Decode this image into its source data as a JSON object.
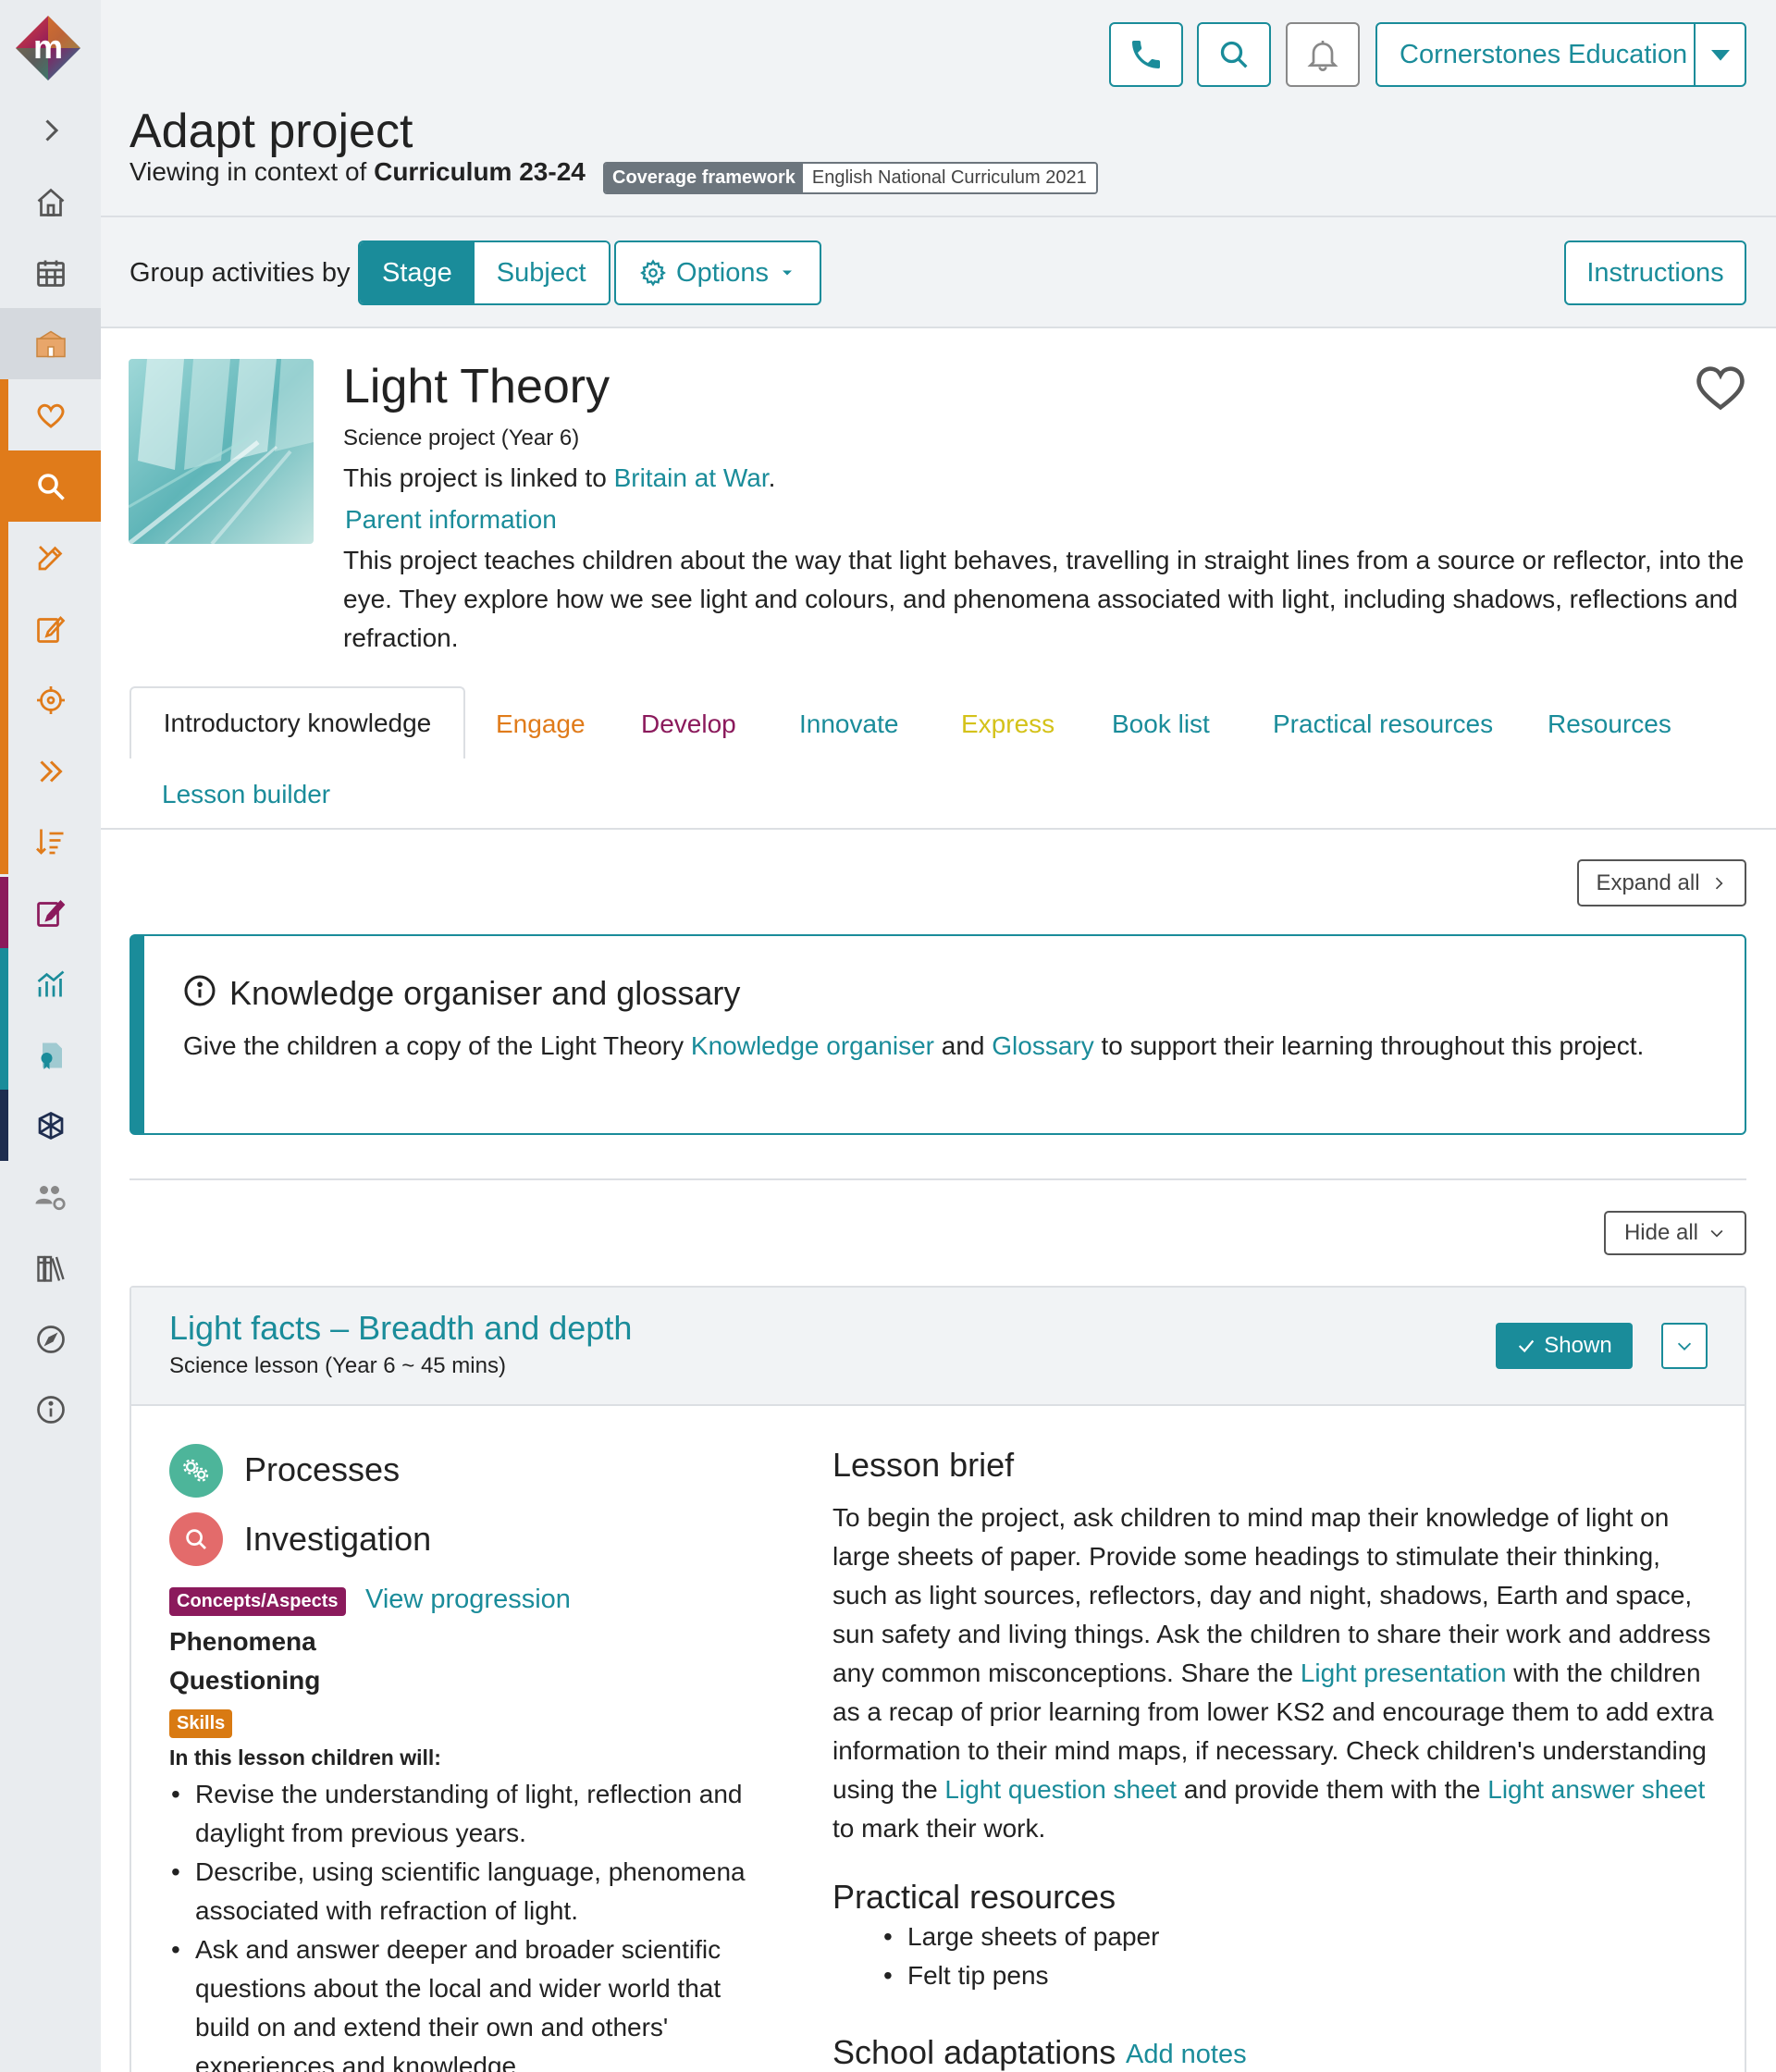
{
  "topbar": {
    "org_name": "Cornerstones Education"
  },
  "header": {
    "title": "Adapt project",
    "context_prefix": "Viewing in context of ",
    "context_value": "Curriculum 23-24",
    "coverage_key": "Coverage framework",
    "coverage_value": "English National Curriculum 2021"
  },
  "toolbar": {
    "group_label": "Group activities by",
    "stage_label": "Stage",
    "subject_label": "Subject",
    "options_label": "Options",
    "instructions_label": "Instructions"
  },
  "project": {
    "title": "Light Theory",
    "subtitle": "Science project (Year 6)",
    "linked_prefix": "This project is linked to ",
    "linked_name": "Britain at War",
    "linked_suffix": ".",
    "parent_info": "Parent information",
    "description": "This project teaches children about the way that light behaves, travelling in straight lines from a source or reflector, into the eye. They explore how we see light and colours, and phenomena associated with light, including shadows, reflections and refraction."
  },
  "tabs": [
    {
      "label": "Introductory knowledge",
      "color": "#222222"
    },
    {
      "label": "Engage",
      "color": "#e07b1a"
    },
    {
      "label": "Develop",
      "color": "#8b1a5c"
    },
    {
      "label": "Innovate",
      "color": "#1a8c9a"
    },
    {
      "label": "Express",
      "color": "#d4c21a"
    },
    {
      "label": "Book list",
      "color": "#1a8c9a"
    },
    {
      "label": "Practical resources",
      "color": "#1a8c9a"
    },
    {
      "label": "Resources",
      "color": "#1a8c9a"
    },
    {
      "label": "Lesson builder",
      "color": "#1a8c9a"
    }
  ],
  "expand_all_label": "Expand all",
  "knowledge_organiser": {
    "title": "Knowledge organiser and glossary",
    "text_prefix": "Give the children a copy of the Light Theory ",
    "link1": "Knowledge organiser",
    "text_mid": " and ",
    "link2": "Glossary",
    "text_suffix": " to support their learning throughout this project."
  },
  "hide_all_label": "Hide all",
  "lesson": {
    "title": "Light facts – Breadth and depth",
    "subtitle": "Science lesson (Year 6 ~ 45 mins)",
    "shown_label": "Shown",
    "process1": "Processes",
    "process2": "Investigation",
    "concepts_badge": "Concepts/Aspects",
    "view_progression": "View progression",
    "concept1": "Phenomena",
    "concept2": "Questioning",
    "skills_badge": "Skills",
    "will_heading": "In this lesson children will:",
    "objectives": [
      "Revise the understanding of light, reflection and daylight from previous years.",
      "Describe, using scientific language, phenomena associated with refraction of light.",
      "Ask and answer deeper and broader scientific questions about the local and wider world that build on and extend their own and others' experiences and knowledge."
    ],
    "brief_title": "Lesson brief",
    "brief_part1": "To begin the project, ask children to mind map their knowledge of light on large sheets of paper. Provide some headings to stimulate their thinking, such as light sources, reflectors, day and night, shadows, Earth and space, sun safety and living things. Ask the children to share their work and address any common misconceptions. Share the ",
    "brief_link1": "Light presentation",
    "brief_part2": " with the children as a recap of prior learning from lower KS2 and encourage them to add extra information to their mind maps, if necessary. Check children's understanding using the ",
    "brief_link2": "Light question sheet",
    "brief_part3": " and provide them with the ",
    "brief_link3": "Light answer sheet",
    "brief_part4": " to mark their work.",
    "practical_title": "Practical resources",
    "practical_items": [
      "Large sheets of paper",
      "Felt tip pens"
    ],
    "adaptations_title": "School adaptations",
    "add_notes": "Add notes"
  },
  "colors": {
    "teal": "#1a8c9a",
    "orange": "#e07b1a",
    "purple": "#8b1a5c",
    "skills_orange": "#d97a12"
  }
}
